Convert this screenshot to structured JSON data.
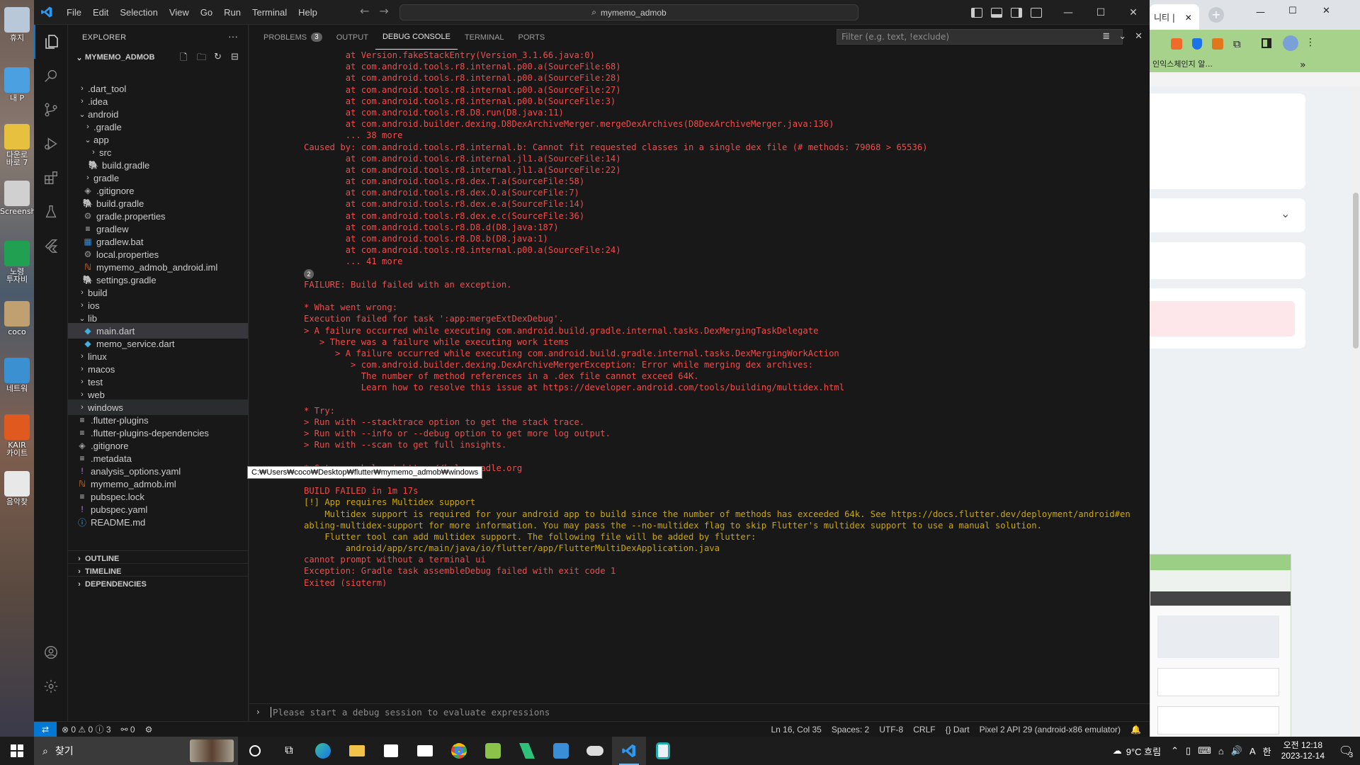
{
  "desktop": {
    "labels": [
      "휴지",
      "내 P",
      "다운로\n바로 7",
      "Screensh",
      "노령\n투자비",
      "coco",
      "네트워",
      "KAIR\n카이트",
      "음악찾"
    ]
  },
  "titlebar": {
    "menu": [
      "File",
      "Edit",
      "Selection",
      "View",
      "Go",
      "Run",
      "Terminal",
      "Help"
    ],
    "search": "mymemo_admob",
    "min": "—",
    "max": "☐",
    "close": "✕"
  },
  "sidebar": {
    "title": "EXPLORER",
    "more": "···",
    "project": "MYMEMO_ADMOB",
    "items": [
      {
        "label": ".dart_tool",
        "depth": 0,
        "type": "folder",
        "open": false
      },
      {
        "label": ".idea",
        "depth": 0,
        "type": "folder",
        "open": false
      },
      {
        "label": "android",
        "depth": 0,
        "type": "folder",
        "open": true
      },
      {
        "label": ".gradle",
        "depth": 1,
        "type": "folder",
        "open": false
      },
      {
        "label": "app",
        "depth": 1,
        "type": "folder",
        "open": true
      },
      {
        "label": "src",
        "depth": 2,
        "type": "folder",
        "open": false
      },
      {
        "label": "build.gradle",
        "depth": 2,
        "type": "gradle"
      },
      {
        "label": "gradle",
        "depth": 1,
        "type": "folder",
        "open": false
      },
      {
        "label": ".gitignore",
        "depth": 1,
        "type": "git"
      },
      {
        "label": "build.gradle",
        "depth": 1,
        "type": "gradle"
      },
      {
        "label": "gradle.properties",
        "depth": 1,
        "type": "gear"
      },
      {
        "label": "gradlew",
        "depth": 1,
        "type": "list"
      },
      {
        "label": "gradlew.bat",
        "depth": 1,
        "type": "win"
      },
      {
        "label": "local.properties",
        "depth": 1,
        "type": "gear"
      },
      {
        "label": "mymemo_admob_android.iml",
        "depth": 1,
        "type": "rss"
      },
      {
        "label": "settings.gradle",
        "depth": 1,
        "type": "gradle"
      },
      {
        "label": "build",
        "depth": 0,
        "type": "folder",
        "open": false
      },
      {
        "label": "ios",
        "depth": 0,
        "type": "folder",
        "open": false
      },
      {
        "label": "lib",
        "depth": 0,
        "type": "folder",
        "open": true
      },
      {
        "label": "main.dart",
        "depth": 1,
        "type": "dart",
        "selected": true
      },
      {
        "label": "memo_service.dart",
        "depth": 1,
        "type": "dart"
      },
      {
        "label": "linux",
        "depth": 0,
        "type": "folder",
        "open": false
      },
      {
        "label": "macos",
        "depth": 0,
        "type": "folder",
        "open": false
      },
      {
        "label": "test",
        "depth": 0,
        "type": "folder",
        "open": false
      },
      {
        "label": "web",
        "depth": 0,
        "type": "folder",
        "open": false
      },
      {
        "label": "windows",
        "depth": 0,
        "type": "folder",
        "open": false,
        "hover": true
      },
      {
        "label": ".flutter-plugins",
        "depth": 0,
        "type": "list"
      },
      {
        "label": ".flutter-plugins-dependencies",
        "depth": 0,
        "type": "list"
      },
      {
        "label": ".gitignore",
        "depth": 0,
        "type": "git"
      },
      {
        "label": ".metadata",
        "depth": 0,
        "type": "list"
      },
      {
        "label": "analysis_options.yaml",
        "depth": 0,
        "type": "yaml"
      },
      {
        "label": "mymemo_admob.iml",
        "depth": 0,
        "type": "rss"
      },
      {
        "label": "pubspec.lock",
        "depth": 0,
        "type": "list"
      },
      {
        "label": "pubspec.yaml",
        "depth": 0,
        "type": "yaml"
      },
      {
        "label": "README.md",
        "depth": 0,
        "type": "info"
      }
    ],
    "outline": "OUTLINE",
    "timeline": "TIMELINE",
    "dependencies": "DEPENDENCIES"
  },
  "panel": {
    "tabs": [
      {
        "label": "PROBLEMS",
        "badge": "3"
      },
      {
        "label": "OUTPUT"
      },
      {
        "label": "DEBUG CONSOLE",
        "active": true
      },
      {
        "label": "TERMINAL"
      },
      {
        "label": "PORTS"
      }
    ],
    "filter_placeholder": "Filter (e.g. text, !exclude)",
    "group_badge": "2",
    "tooltip": "C:₩Users₩coco₩Desktop₩flutter₩mymemo_admob₩windows",
    "repl_placeholder": "Please start a debug session to evaluate expressions",
    "console_lines": [
      {
        "t": "        at Version.fakeStackEntry(Version_3.1.66.java:0)",
        "c": "err"
      },
      {
        "t": "        at com.android.tools.r8.internal.p00.a(SourceFile:68)",
        "c": "err"
      },
      {
        "t": "        at com.android.tools.r8.internal.p00.a(SourceFile:28)",
        "c": "err"
      },
      {
        "t": "        at com.android.tools.r8.internal.p00.a(SourceFile:27)",
        "c": "err"
      },
      {
        "t": "        at com.android.tools.r8.internal.p00.b(SourceFile:3)",
        "c": "err"
      },
      {
        "t": "        at com.android.tools.r8.D8.run(D8.java:11)",
        "c": "err"
      },
      {
        "t": "        at com.android.builder.dexing.D8DexArchiveMerger.mergeDexArchives(D8DexArchiveMerger.java:136)",
        "c": "err"
      },
      {
        "t": "        ... 38 more",
        "c": "err"
      },
      {
        "t": "Caused by: com.android.tools.r8.internal.b: Cannot fit requested classes in a single dex file (# methods: 79068 > 65536)",
        "c": "err"
      },
      {
        "t": "        at com.android.tools.r8.internal.jl1.a(SourceFile:14)",
        "c": "err"
      },
      {
        "t": "        at com.android.tools.r8.internal.jl1.a(SourceFile:22)",
        "c": "err"
      },
      {
        "t": "        at com.android.tools.r8.dex.T.a(SourceFile:58)",
        "c": "err"
      },
      {
        "t": "        at com.android.tools.r8.dex.O.a(SourceFile:7)",
        "c": "err"
      },
      {
        "t": "        at com.android.tools.r8.dex.e.a(SourceFile:14)",
        "c": "err"
      },
      {
        "t": "        at com.android.tools.r8.dex.e.c(SourceFile:36)",
        "c": "err"
      },
      {
        "t": "        at com.android.tools.r8.D8.d(D8.java:187)",
        "c": "err"
      },
      {
        "t": "        at com.android.tools.r8.D8.b(D8.java:1)",
        "c": "err"
      },
      {
        "t": "        at com.android.tools.r8.internal.p00.a(SourceFile:24)",
        "c": "err"
      },
      {
        "t": "        ... 41 more",
        "c": "err"
      },
      {
        "t": "",
        "c": "badge"
      },
      {
        "t": "FAILURE: Build failed with an exception.",
        "c": "err"
      },
      {
        "t": "",
        "c": "err"
      },
      {
        "t": "* What went wrong:",
        "c": "err"
      },
      {
        "t": "Execution failed for task ':app:mergeExtDexDebug'.",
        "c": "err"
      },
      {
        "t": "> A failure occurred while executing com.android.build.gradle.internal.tasks.DexMergingTaskDelegate",
        "c": "err"
      },
      {
        "t": "   > There was a failure while executing work items",
        "c": "err"
      },
      {
        "t": "      > A failure occurred while executing com.android.build.gradle.internal.tasks.DexMergingWorkAction",
        "c": "err"
      },
      {
        "t": "         > com.android.builder.dexing.DexArchiveMergerException: Error while merging dex archives:",
        "c": "err"
      },
      {
        "t": "           The number of method references in a .dex file cannot exceed 64K.",
        "c": "err"
      },
      {
        "t": "           Learn how to resolve this issue at https://developer.android.com/tools/building/multidex.html",
        "c": "err"
      },
      {
        "t": "",
        "c": "err"
      },
      {
        "t": "* Try:",
        "c": "err"
      },
      {
        "t": "> Run with --stacktrace option to get the stack trace.",
        "c": "err"
      },
      {
        "t": "> Run with --info or --debug option to get more log output.",
        "c": "err"
      },
      {
        "t": "> Run with --scan to get full insights.",
        "c": "err"
      },
      {
        "t": "",
        "c": "err"
      },
      {
        "t": "* Get more help at https://help.gradle.org",
        "c": "err"
      },
      {
        "t": "",
        "c": "err"
      },
      {
        "t": "BUILD FAILED in 1m 17s",
        "c": "err"
      },
      {
        "t": "[!] App requires Multidex support",
        "c": "warn"
      },
      {
        "t": "    Multidex support is required for your android app to build since the number of methods has exceeded 64k. See https://docs.flutter.dev/deployment/android#en",
        "c": "warn"
      },
      {
        "t": "abling-multidex-support for more information. You may pass the --no-multidex flag to skip Flutter's multidex support to use a manual solution.",
        "c": "warn"
      },
      {
        "t": "    Flutter tool can add multidex support. The following file will be added by flutter:",
        "c": "warn"
      },
      {
        "t": "        android/app/src/main/java/io/flutter/app/FlutterMultiDexApplication.java",
        "c": "warn"
      },
      {
        "t": "cannot prompt without a terminal ui",
        "c": "err"
      },
      {
        "t": "Exception: Gradle task assembleDebug failed with exit code 1",
        "c": "err"
      },
      {
        "t": "Exited (sigterm)",
        "c": "err"
      }
    ]
  },
  "statusbar": {
    "remote": "⇄",
    "problems": "⊗ 0 ⚠ 0 ⓘ 3",
    "ports": "⚯ 0",
    "position": "Ln 16, Col 35",
    "spaces": "Spaces: 2",
    "encoding": "UTF-8",
    "eol": "CRLF",
    "language": "{} Dart",
    "device": "Pixel 2 API 29 (android-x86 emulator)"
  },
  "browser": {
    "tab_title": "니티 |",
    "tab_close": "✕",
    "new_tab": "+",
    "bookmark": "인익스체인지 알...",
    "bookmark_more": "»"
  },
  "taskbar": {
    "search_text": "찾기",
    "weather": "9°C 흐림",
    "ime": "A",
    "ime2": "한",
    "time": "오전 12:18",
    "date": "2023-12-14",
    "notif": "3"
  },
  "colors": {
    "error": "#f14c4c",
    "warning": "#cca700",
    "accent": "#0078d4",
    "browser_toolbar": "#a7d28c"
  }
}
